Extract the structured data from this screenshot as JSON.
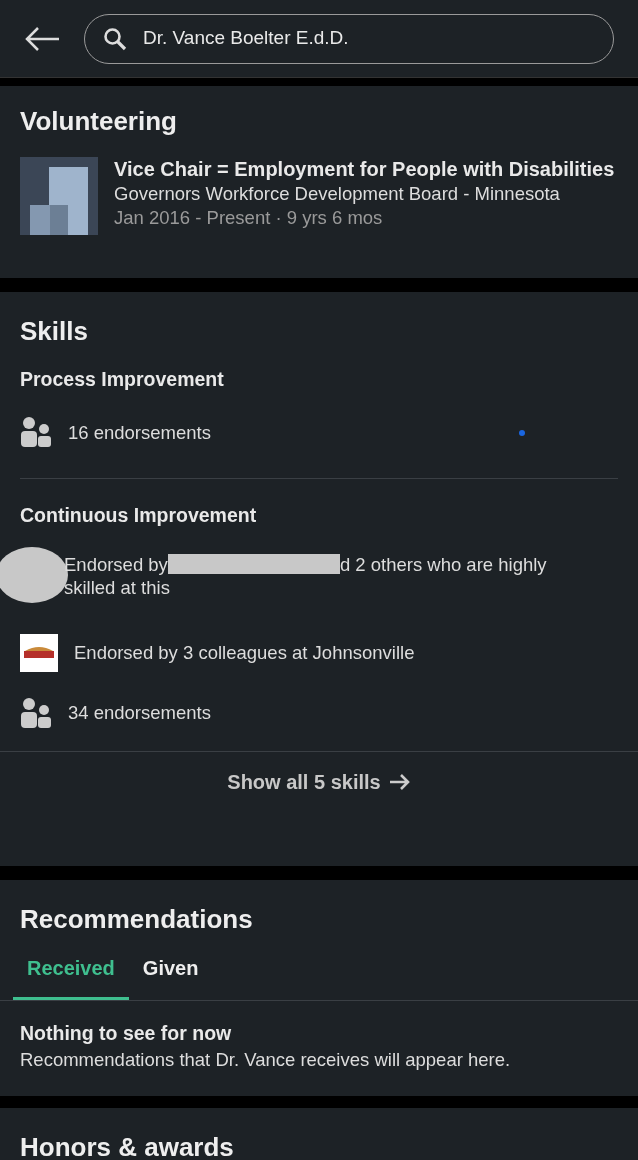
{
  "search": {
    "value": "Dr. Vance Boelter E.d.D."
  },
  "volunteering": {
    "title": "Volunteering",
    "items": [
      {
        "role": "Vice Chair = Employment for People with Disabilities",
        "organization": "Governors Workforce Development Board - Minnesota",
        "dates": "Jan 2016 - Present · 9 yrs 6 mos"
      }
    ]
  },
  "skills": {
    "title": "Skills",
    "items": [
      {
        "name": "Process Improvement",
        "details": [
          {
            "kind": "count",
            "text": "16 endorsements"
          }
        ]
      },
      {
        "name": "Continuous Improvement",
        "details": [
          {
            "kind": "person",
            "text_before": "Endorsed by",
            "text_after_lines": [
              "d 2 others who are highly",
              "skilled at this"
            ]
          },
          {
            "kind": "company",
            "text": "Endorsed by 3 colleagues at Johnsonville"
          },
          {
            "kind": "count",
            "text": "34 endorsements"
          }
        ]
      }
    ],
    "show_all": "Show all 5 skills"
  },
  "recommendations": {
    "title": "Recommendations",
    "tabs": [
      {
        "label": "Received",
        "selected": true
      },
      {
        "label": "Given",
        "selected": false
      }
    ],
    "empty_title": "Nothing to see for now",
    "empty_text": "Recommendations that Dr. Vance receives will appear here."
  },
  "honors": {
    "title": "Honors & awards"
  }
}
